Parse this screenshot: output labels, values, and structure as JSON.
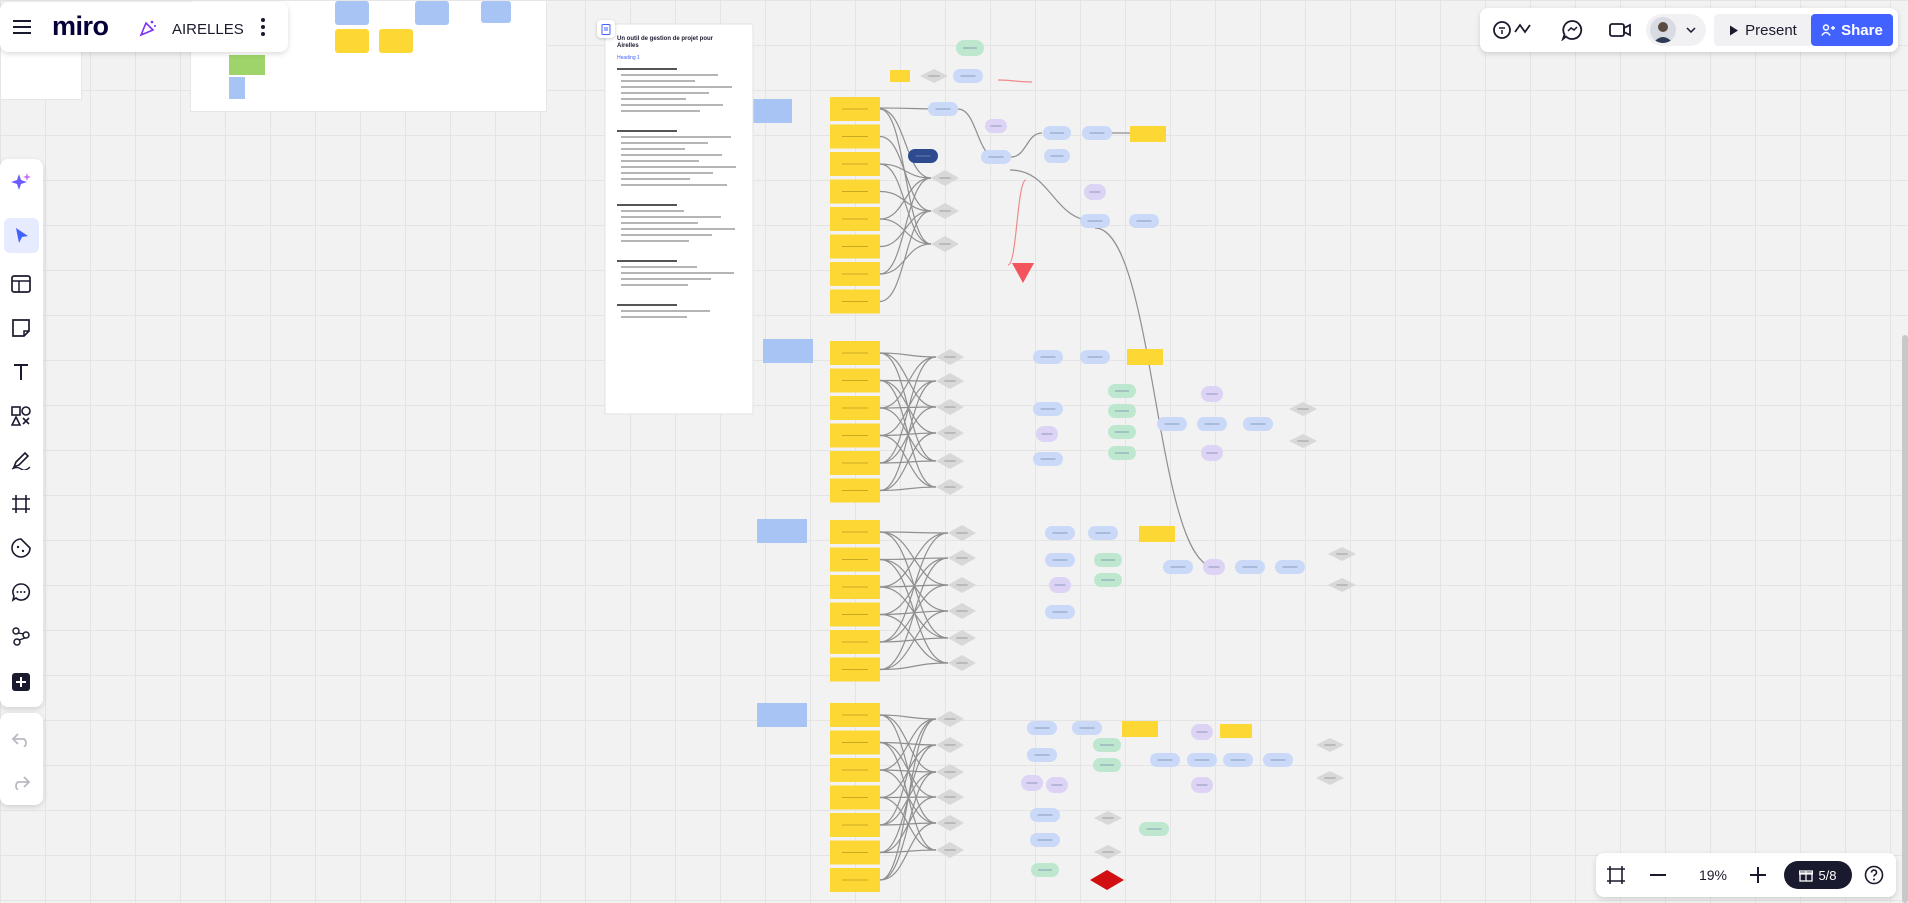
{
  "app": {
    "logo": "miro",
    "board_name": "AIRELLES"
  },
  "board": {
    "doc_title_line1": "Un outil de gestion de projet pour",
    "doc_title_line2": "Airelles",
    "doc_heading": "Heading 1"
  },
  "header": {
    "present_label": "Present",
    "share_label": "Share"
  },
  "bottom": {
    "zoom": "19%",
    "page_counter": "5/8"
  },
  "colors": {
    "accent": "#4262ff",
    "sticky_yellow": "#fdd835",
    "shape_blue": "#a7c4f5",
    "node_blue": "#c9d9f7",
    "node_green": "#bde8cf",
    "node_purple": "#ddd3f5",
    "node_gray": "#d8d8d8",
    "alert_red": "#f2555e",
    "diamond_red": "#d10f12"
  },
  "icons": {
    "menu": "hamburger-icon",
    "more": "more-vertical-icon",
    "ai": "sparkle-icon",
    "select": "cursor-icon",
    "templates": "templates-icon",
    "sticky": "sticky-note-icon",
    "text": "text-icon",
    "shapes": "shapes-icon",
    "pen": "pen-icon",
    "frame": "frame-icon",
    "emoji": "sticker-icon",
    "comment": "comment-icon",
    "diagram": "diagram-icon",
    "plus": "add-icon",
    "undo": "undo-icon",
    "redo": "redo-icon",
    "reactions": "reactions-icon",
    "chat": "chat-icon",
    "video": "video-icon",
    "play": "play-icon",
    "share": "share-icon",
    "fit": "fit-screen-icon",
    "zoom_out": "minus-icon",
    "zoom_in": "plus-icon",
    "gift": "gift-icon",
    "help": "help-icon"
  }
}
